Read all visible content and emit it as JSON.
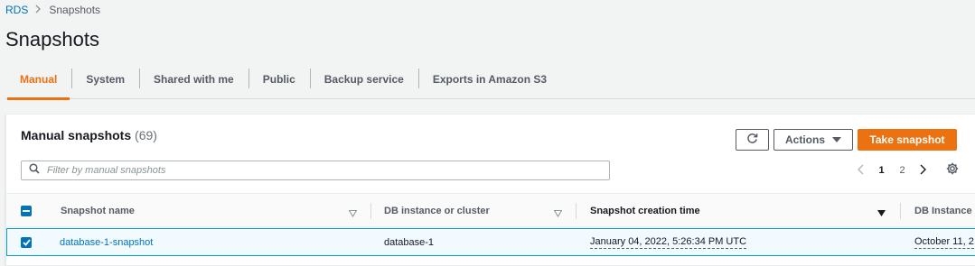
{
  "breadcrumb": {
    "root": "RDS",
    "current": "Snapshots"
  },
  "page_title": "Snapshots",
  "tabs": [
    {
      "label": "Manual",
      "active": true
    },
    {
      "label": "System",
      "active": false
    },
    {
      "label": "Shared with me",
      "active": false
    },
    {
      "label": "Public",
      "active": false
    },
    {
      "label": "Backup service",
      "active": false
    },
    {
      "label": "Exports in Amazon S3",
      "active": false
    }
  ],
  "panel": {
    "title": "Manual snapshots",
    "count": "(69)",
    "actions_label": "Actions",
    "take_snapshot_label": "Take snapshot"
  },
  "search": {
    "placeholder": "Filter by manual snapshots",
    "value": ""
  },
  "pagination": {
    "pages": [
      "1",
      "2"
    ],
    "current": "1"
  },
  "table": {
    "columns": [
      "Snapshot name",
      "DB instance or cluster",
      "Snapshot creation time",
      "DB Instance"
    ],
    "rows": [
      {
        "selected": true,
        "name": "database-1-snapshot",
        "db_instance": "database-1",
        "creation_time": "January 04, 2022, 5:26:34 PM UTC",
        "db_instance_created": "October 11, 2"
      }
    ]
  },
  "colors": {
    "accent": "#ec7211",
    "link": "#0073bb",
    "selected_row": "#f1faff"
  },
  "icons": [
    "chevron-right-icon",
    "refresh-icon",
    "caret-down-icon",
    "search-icon",
    "chevron-left-icon",
    "settings-gear-icon",
    "sort-icon",
    "checkbox-icon"
  ]
}
